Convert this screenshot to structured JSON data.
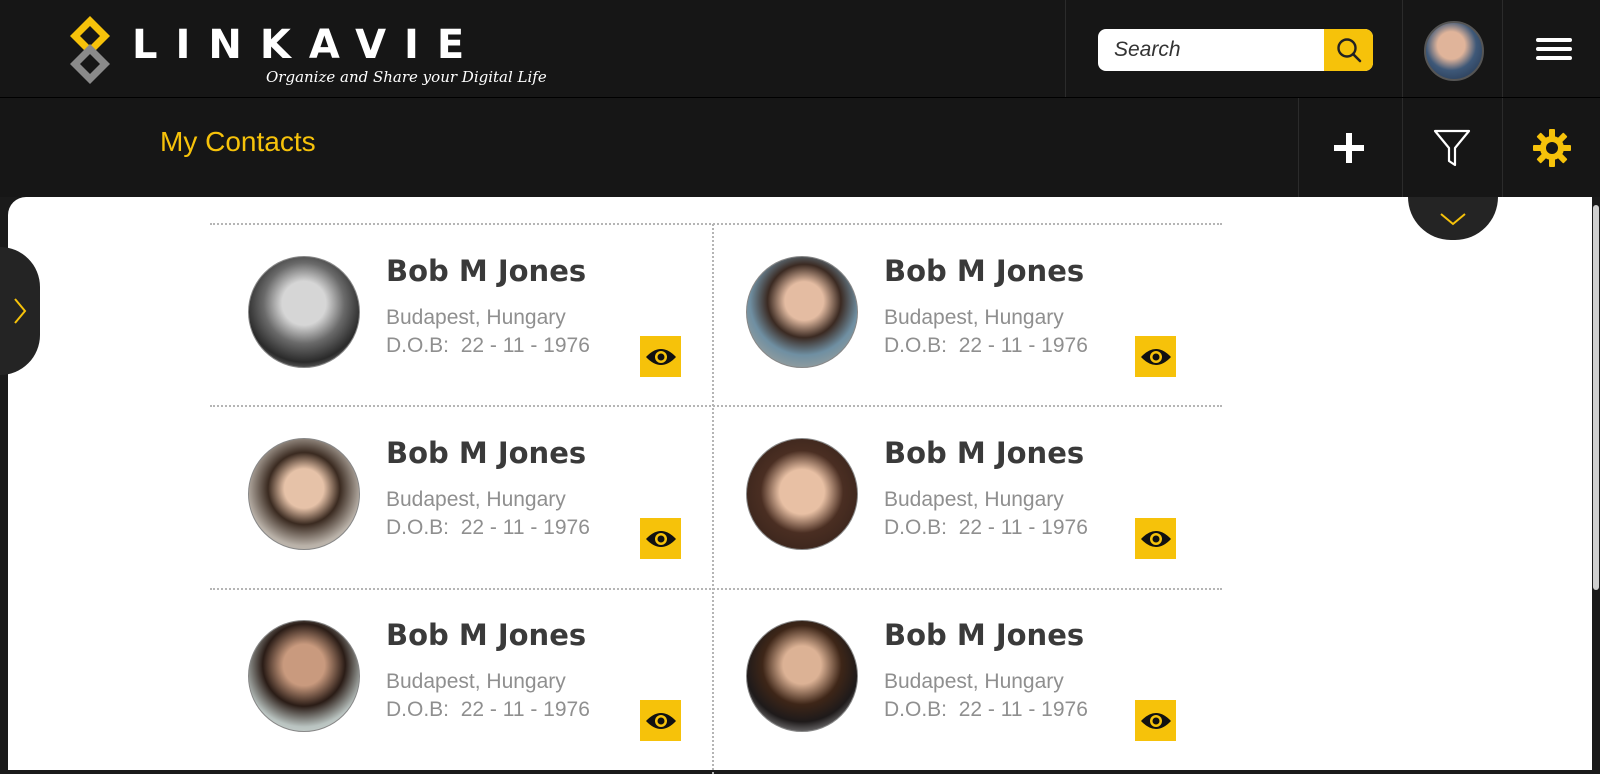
{
  "header": {
    "logo_text": "LINKAVIE",
    "tagline": "Organize and Share your Digital Life",
    "search_placeholder": "Search"
  },
  "subheader": {
    "title": "My Contacts",
    "tools": [
      "plus-icon",
      "filter-icon",
      "gear-icon"
    ]
  },
  "colors": {
    "accent": "#f6c20a",
    "bar": "#161616",
    "text_dark": "#3a3a3a",
    "text_muted": "#8f8f8f"
  },
  "contacts": [
    {
      "name": "Bob M Jones",
      "location": "Budapest, Hungary",
      "dob_label": "D.O.B:",
      "dob": "22 - 11 - 1976"
    },
    {
      "name": "Bob M Jones",
      "location": "Budapest, Hungary",
      "dob_label": "D.O.B:",
      "dob": "22 - 11 - 1976"
    },
    {
      "name": "Bob M Jones",
      "location": "Budapest, Hungary",
      "dob_label": "D.O.B:",
      "dob": "22 - 11 - 1976"
    },
    {
      "name": "Bob M Jones",
      "location": "Budapest, Hungary",
      "dob_label": "D.O.B:",
      "dob": "22 - 11 - 1976"
    },
    {
      "name": "Bob M Jones",
      "location": "Budapest, Hungary",
      "dob_label": "D.O.B:",
      "dob": "22 - 11 - 1976"
    },
    {
      "name": "Bob M Jones",
      "location": "Budapest, Hungary",
      "dob_label": "D.O.B:",
      "dob": "22 - 11 - 1976"
    }
  ]
}
